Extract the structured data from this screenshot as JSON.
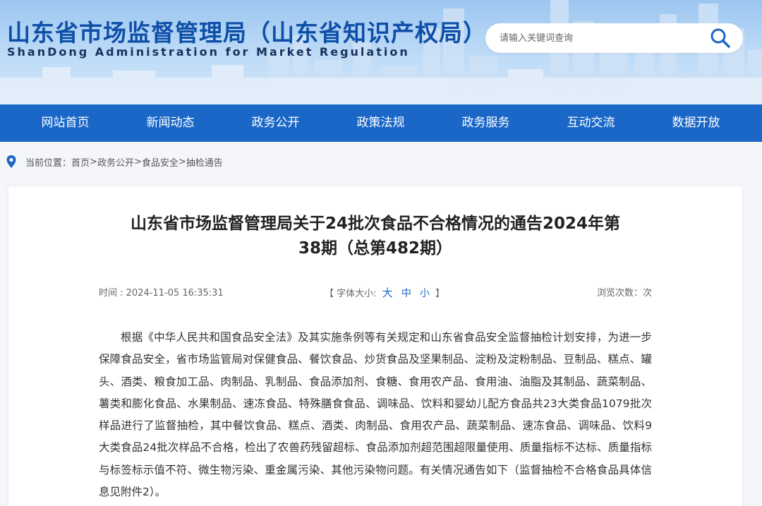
{
  "header": {
    "title": "山东省市场监督管理局（山东省知识产权局）",
    "subtitle": "ShanDong Administration for Market Regulation",
    "search_placeholder": "请输入关键词查询"
  },
  "nav": {
    "items": [
      "网站首页",
      "新闻动态",
      "政务公开",
      "政策法规",
      "政务服务",
      "互动交流",
      "数据开放"
    ]
  },
  "breadcrumb": {
    "label": "当前位置：",
    "items": [
      "首页",
      "政务公开",
      "食品安全",
      "抽检通告"
    ],
    "separator": ">"
  },
  "article": {
    "title_line1": "山东省市场监督管理局关于24批次食品不合格情况的通告2024年第",
    "title_line2": "38期（总第482期）",
    "time": "时间 : 2024-11-05 16:35:31",
    "font_size_open": "【 字体大小:",
    "font_size_big": "大",
    "font_size_medium": "中",
    "font_size_small": "小",
    "font_size_close": "】",
    "views": "浏览次数：次",
    "body": "根据《中华人民共和国食品安全法》及其实施条例等有关规定和山东省食品安全监督抽检计划安排，为进一步保障食品安全，省市场监管局对保健食品、餐饮食品、炒货食品及坚果制品、淀粉及淀粉制品、豆制品、糕点、罐头、酒类、粮食加工品、肉制品、乳制品、食品添加剂、食糖、食用农产品、食用油、油脂及其制品、蔬菜制品、薯类和膨化食品、水果制品、速冻食品、特殊膳食食品、调味品、饮料和婴幼儿配方食品共23大类食品1079批次样品进行了监督抽检，其中餐饮食品、糕点、酒类、肉制品、食用农产品、蔬菜制品、速冻食品、调味品、饮料9大类食品24批次样品不合格，检出了农兽药残留超标、食品添加剂超范围超限量使用、质量指标不达标、质量指标与标签标示值不符、微生物污染、重金属污染、其他污染物问题。有关情况通告如下（监督抽检不合格食品具体信息见附件2）。"
  },
  "colors": {
    "nav_bg": "#1a67c8",
    "title_blue": "#0e4fa8",
    "accent": "#1a67c8"
  },
  "icons": {
    "search": "search-icon",
    "location": "location-pin-icon"
  }
}
